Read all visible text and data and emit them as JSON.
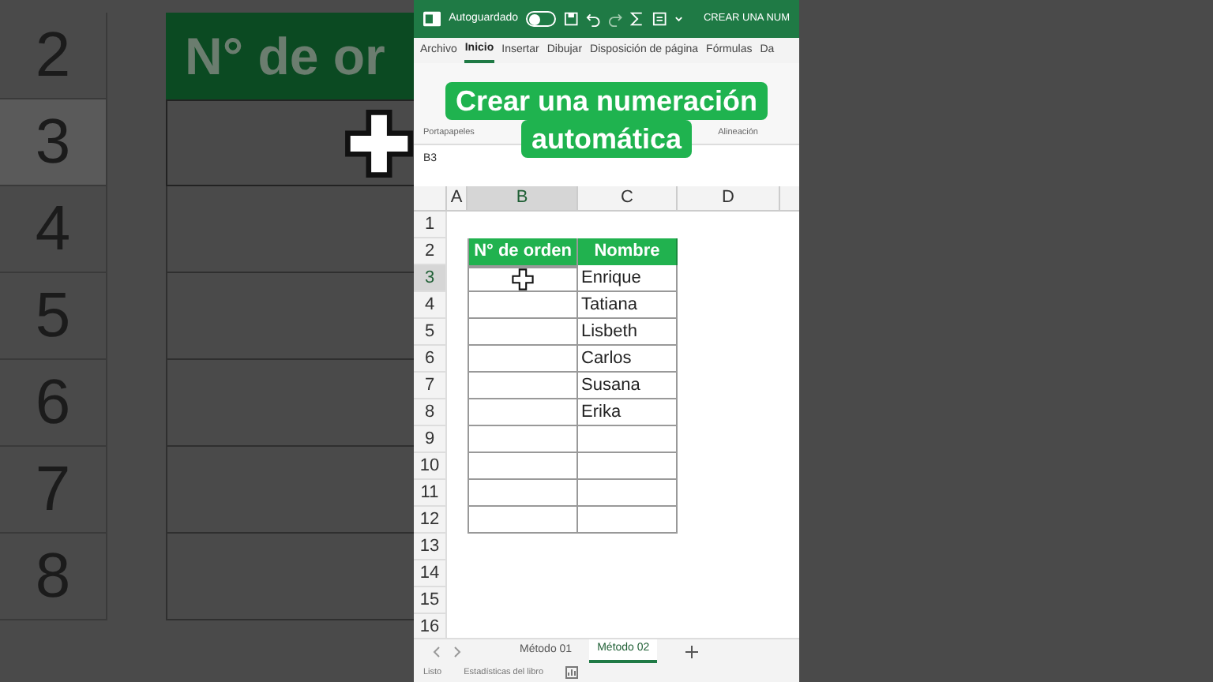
{
  "backdrop": {
    "rows": [
      {
        "number": "2",
        "selected": false,
        "kind": "header"
      },
      {
        "number": "3",
        "selected": true,
        "kind": "cursor"
      },
      {
        "number": "4",
        "selected": false,
        "kind": "cell"
      },
      {
        "number": "5",
        "selected": false,
        "kind": "cell"
      },
      {
        "number": "6",
        "selected": false,
        "kind": "cell"
      },
      {
        "number": "7",
        "selected": false,
        "kind": "cell"
      },
      {
        "number": "8",
        "selected": false,
        "kind": "cell"
      }
    ],
    "header_fragment": "N° de or"
  },
  "title_bar": {
    "autosave_label": "Autoguardado",
    "autosave_on": false,
    "title": "CREAR UNA NUM"
  },
  "ribbon_tabs": [
    {
      "label": "Archivo",
      "selected": false
    },
    {
      "label": "Inicio",
      "selected": true
    },
    {
      "label": "Insertar",
      "selected": false
    },
    {
      "label": "Dibujar",
      "selected": false
    },
    {
      "label": "Disposición de página",
      "selected": false
    },
    {
      "label": "Fórmulas",
      "selected": false
    },
    {
      "label": "Da",
      "selected": false
    }
  ],
  "ribbon_groups": [
    "Portapapeles",
    "Alineación"
  ],
  "name_box": "B3",
  "caption": [
    "Crear una numeración",
    "automática"
  ],
  "columns": [
    {
      "label": "A",
      "selected": false
    },
    {
      "label": "B",
      "selected": true
    },
    {
      "label": "C",
      "selected": false
    },
    {
      "label": "D",
      "selected": false
    }
  ],
  "rows": [
    {
      "number": "1",
      "selected": false,
      "kind": "empty"
    },
    {
      "number": "2",
      "selected": false,
      "kind": "header",
      "b": "N° de orden",
      "c": "Nombre"
    },
    {
      "number": "3",
      "selected": true,
      "kind": "cursor",
      "c": "Enrique"
    },
    {
      "number": "4",
      "selected": false,
      "kind": "table",
      "c": "Tatiana"
    },
    {
      "number": "5",
      "selected": false,
      "kind": "table",
      "c": "Lisbeth"
    },
    {
      "number": "6",
      "selected": false,
      "kind": "table",
      "c": "Carlos"
    },
    {
      "number": "7",
      "selected": false,
      "kind": "table",
      "c": "Susana"
    },
    {
      "number": "8",
      "selected": false,
      "kind": "table",
      "c": "Erika"
    },
    {
      "number": "9",
      "selected": false,
      "kind": "table"
    },
    {
      "number": "10",
      "selected": false,
      "kind": "table"
    },
    {
      "number": "11",
      "selected": false,
      "kind": "table"
    },
    {
      "number": "12",
      "selected": false,
      "kind": "table"
    },
    {
      "number": "13",
      "selected": false,
      "kind": "empty"
    },
    {
      "number": "14",
      "selected": false,
      "kind": "empty"
    },
    {
      "number": "15",
      "selected": false,
      "kind": "empty"
    },
    {
      "number": "16",
      "selected": false,
      "kind": "empty"
    }
  ],
  "sheet_tabs": [
    {
      "label": "Método 01",
      "selected": false
    },
    {
      "label": "Método 02",
      "selected": true
    }
  ],
  "status_bar": [
    "Listo",
    "Estadísticas del libro"
  ]
}
